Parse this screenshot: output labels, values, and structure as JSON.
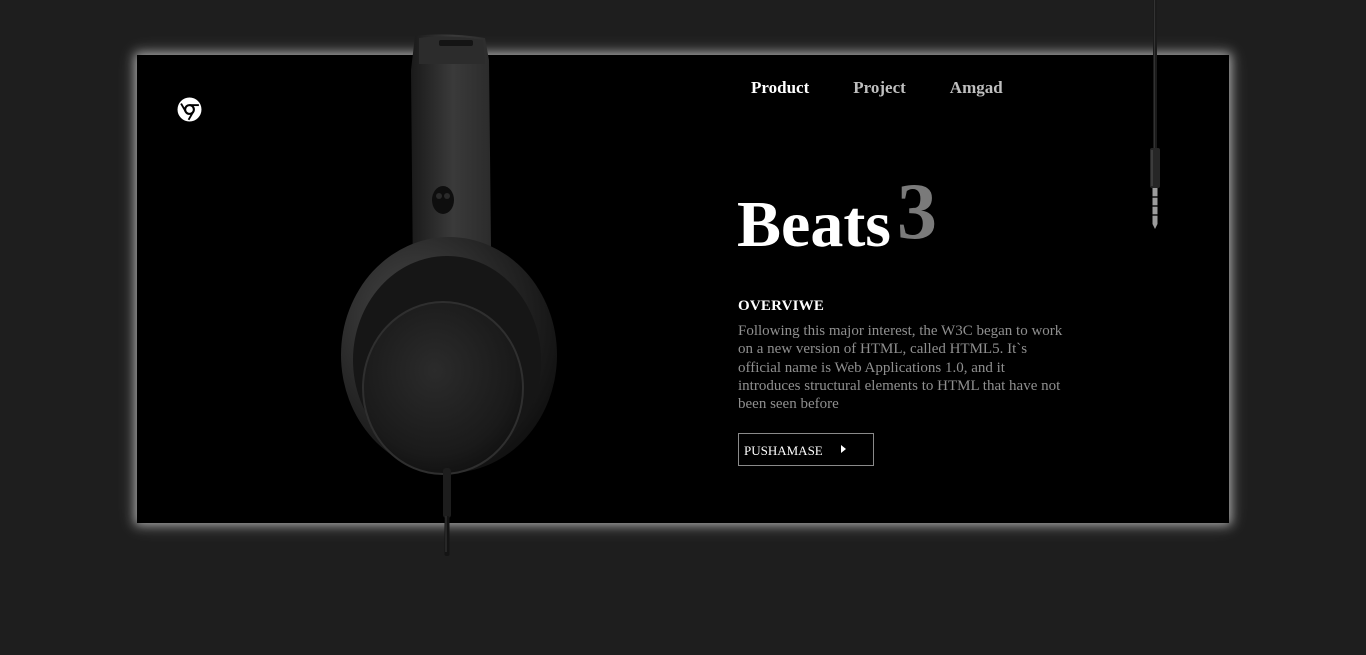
{
  "nav": {
    "items": [
      {
        "label": "Product"
      },
      {
        "label": "Project"
      },
      {
        "label": "Amgad"
      }
    ]
  },
  "hero": {
    "title_word": "Beats",
    "title_number": "3",
    "section_title": "OVERVIWE",
    "description": "Following this major interest, the W3C began to work on a new version of HTML, called HTML5. It`s official name is Web Applications 1.0, and it introduces structural elements to HTML that have not been seen before",
    "button_label": "PUSHAMASE"
  },
  "icons": {
    "logo": "chrome-logo-icon",
    "button_arrow": "caret-right-icon",
    "product_image": "headphones-image",
    "cable_image": "audio-jack-cable-image"
  },
  "colors": {
    "page_background": "#1e1e1e",
    "card_background": "#000000",
    "accent_number": "#7a7a7a",
    "text_muted": "#8f8f8f",
    "text_primary": "#ffffff"
  }
}
